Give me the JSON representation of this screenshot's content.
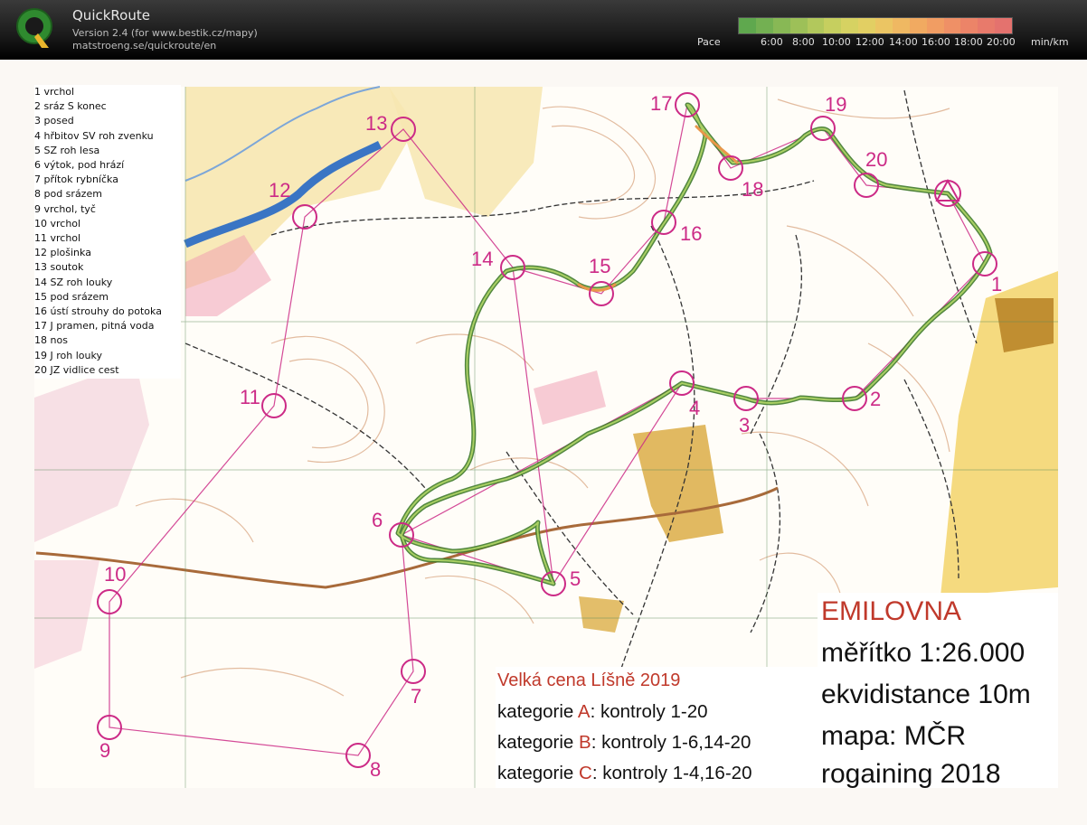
{
  "app": {
    "title": "QuickRoute",
    "version": "Version 2.4  (for www.bestik.cz/mapy)",
    "url": "matstroeng.se/quickroute/en",
    "logo_letter": "Q"
  },
  "pace": {
    "label": "Pace",
    "ticks": [
      "6:00",
      "8:00",
      "10:00",
      "12:00",
      "14:00",
      "16:00",
      "18:00",
      "20:00"
    ],
    "unit": "min/km",
    "colors": [
      "#5fa84e",
      "#73b052",
      "#88b855",
      "#9dc058",
      "#b2c85c",
      "#c6cf5f",
      "#d6d262",
      "#e2cf63",
      "#ebc563",
      "#efb862",
      "#f1aa61",
      "#f19d63",
      "#ef9066",
      "#ec8468",
      "#e87a6b",
      "#e4726e"
    ]
  },
  "legend": [
    "1 vrchol",
    "2 sráz S konec",
    "3 posed",
    "4 hřbitov SV roh zvenku",
    "5 SZ roh lesa",
    "6 výtok, pod hrází",
    "7 přítok rybníčka",
    "8 pod srázem",
    "9 vrchol, tyč",
    "10 vrchol",
    "11 vrchol",
    "12 plošinka",
    "13 soutok",
    "14 SZ roh louky",
    "15 pod srázem",
    "16 ústí strouhy do potoka",
    "17 J pramen, pitná voda",
    "18 nos",
    "19 J roh louky",
    "20 JZ vidlice cest"
  ],
  "event": {
    "title": "Velká cena Líšně 2019",
    "lines": [
      {
        "prefix": "kategorie ",
        "cat": "A",
        "suffix": ": kontroly 1-20"
      },
      {
        "prefix": "kategorie ",
        "cat": "B",
        "suffix": ": kontroly 1-6,14-20"
      },
      {
        "prefix": "kategorie ",
        "cat": "C",
        "suffix": ": kontroly 1-4,16-20"
      }
    ]
  },
  "map_info": {
    "name": "EMILOVNA",
    "lines": [
      "měřítko 1:26.000",
      "ekvidistance 10m",
      "mapa: MČR",
      "rogaining 2018"
    ]
  },
  "controls": [
    "1",
    "2",
    "3",
    "4",
    "5",
    "6",
    "7",
    "8",
    "9",
    "10",
    "11",
    "12",
    "13",
    "14",
    "15",
    "16",
    "17",
    "18",
    "19",
    "20"
  ],
  "colors": {
    "course": "#cc2a86",
    "route": "#5e9a3a",
    "accent_red": "#c0392b"
  }
}
